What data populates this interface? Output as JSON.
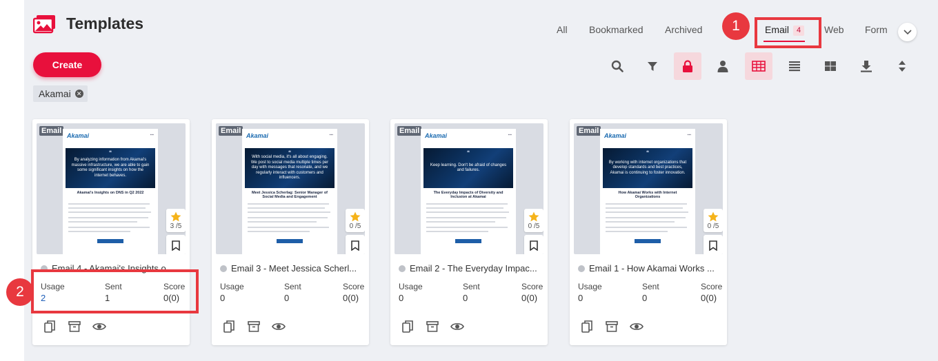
{
  "header": {
    "title": "Templates"
  },
  "tabs": [
    {
      "label": "All"
    },
    {
      "label": "Bookmarked"
    },
    {
      "label": "Archived"
    },
    {
      "label": "Email",
      "count": "4"
    },
    {
      "label": "Web"
    },
    {
      "label": "Form"
    }
  ],
  "annotations": [
    "1",
    "2"
  ],
  "toolbar": {
    "create_label": "Create"
  },
  "filter_chip": {
    "label": "Akamai"
  },
  "stats_labels": {
    "usage": "Usage",
    "sent": "Sent",
    "score": "Score"
  },
  "cards": [
    {
      "badge": "Email",
      "title": "Email 4 - Akamai's Insights o...",
      "rating": "3 /5",
      "usage": "2",
      "sent": "1",
      "score": "0(0)",
      "preview": {
        "quote": "By analyzing information from Akamai's massive infrastructure, we are able to gain some significant insights on how the internet behaves.",
        "heading": "Akamai's Insights on DNS in Q2 2022"
      }
    },
    {
      "badge": "Email",
      "title": "Email 3 - Meet Jessica Scherl...",
      "rating": "0 /5",
      "usage": "0",
      "sent": "0",
      "score": "0(0)",
      "preview": {
        "quote": "With social media, it's all about engaging. We post to social media multiple times per day with messages that resonate, and we regularly interact with customers and influencers.",
        "heading": "Meet Jessica Scherlag: Senior Manager of Social Media and Engagement"
      }
    },
    {
      "badge": "Email",
      "title": "Email 2 - The Everyday Impac...",
      "rating": "0 /5",
      "usage": "0",
      "sent": "0",
      "score": "0(0)",
      "preview": {
        "quote": "Keep learning. Don't be afraid of changes and failures.",
        "heading": "The Everyday Impacts of Diversity and Inclusion at Akamai"
      }
    },
    {
      "badge": "Email",
      "title": "Email 1 - How Akamai Works ...",
      "rating": "0 /5",
      "usage": "0",
      "sent": "0",
      "score": "0(0)",
      "preview": {
        "quote": "By working with internet organizations that develop standards and best practices, Akamai is continuing to foster innovation.",
        "heading": "How Akamai Works with Internet Organizations"
      }
    }
  ],
  "preview_logo": "Akamai",
  "colors": {
    "brand": "#e8103c",
    "annotation": "#e8383f",
    "link": "#1e5eb8",
    "background": "#eef0f4"
  }
}
